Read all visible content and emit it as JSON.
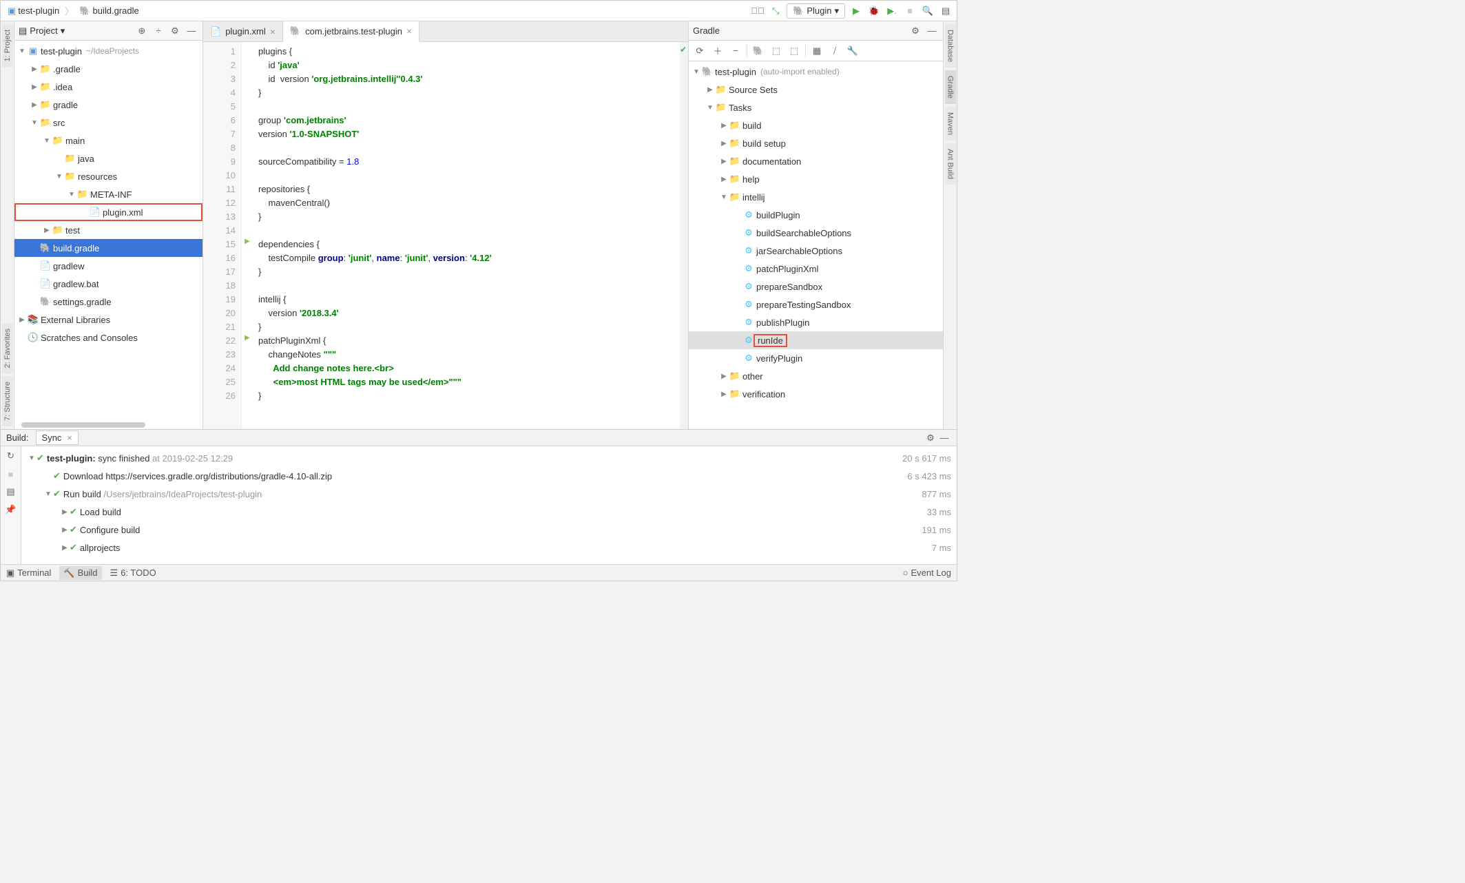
{
  "breadcrumb": {
    "project": "test-plugin",
    "file": "build.gradle"
  },
  "runConfig": {
    "label": "Plugin"
  },
  "projectPanel": {
    "title": "Project",
    "root": {
      "name": "test-plugin",
      "hint": "~/IdeaProjects"
    },
    "items": [
      {
        "name": ".gradle",
        "indent": 1,
        "arrow": "▶",
        "icon": "folder-orange"
      },
      {
        "name": ".idea",
        "indent": 1,
        "arrow": "▶",
        "icon": "folder"
      },
      {
        "name": "gradle",
        "indent": 1,
        "arrow": "▶",
        "icon": "folder"
      },
      {
        "name": "src",
        "indent": 1,
        "arrow": "▼",
        "icon": "folder-blue"
      },
      {
        "name": "main",
        "indent": 2,
        "arrow": "▼",
        "icon": "folder-blue"
      },
      {
        "name": "java",
        "indent": 3,
        "arrow": "",
        "icon": "folder-blue"
      },
      {
        "name": "resources",
        "indent": 3,
        "arrow": "▼",
        "icon": "folder-blue"
      },
      {
        "name": "META-INF",
        "indent": 4,
        "arrow": "▼",
        "icon": "folder"
      },
      {
        "name": "plugin.xml",
        "indent": 5,
        "arrow": "",
        "icon": "file",
        "highlight": true
      },
      {
        "name": "test",
        "indent": 2,
        "arrow": "▶",
        "icon": "folder-blue"
      },
      {
        "name": "build.gradle",
        "indent": 1,
        "arrow": "",
        "icon": "gradle",
        "selected": true
      },
      {
        "name": "gradlew",
        "indent": 1,
        "arrow": "",
        "icon": "file"
      },
      {
        "name": "gradlew.bat",
        "indent": 1,
        "arrow": "",
        "icon": "file"
      },
      {
        "name": "settings.gradle",
        "indent": 1,
        "arrow": "",
        "icon": "gradle"
      }
    ],
    "extLibs": "External Libraries",
    "scratches": "Scratches and Consoles"
  },
  "editor": {
    "tabs": [
      {
        "label": "plugin.xml",
        "active": false
      },
      {
        "label": "com.jetbrains.test-plugin",
        "active": true
      }
    ],
    "lineCount": 26,
    "code": [
      {
        "t": "plugins {"
      },
      {
        "t": "    id ",
        "s": "'java'"
      },
      {
        "t": "    id ",
        "s": "'org.jetbrains.intellij'",
        "t2": " version ",
        "s2": "'0.4.3'"
      },
      {
        "t": "}"
      },
      {
        "t": ""
      },
      {
        "t": "group ",
        "s": "'com.jetbrains'"
      },
      {
        "t": "version ",
        "s": "'1.0-SNAPSHOT'"
      },
      {
        "t": ""
      },
      {
        "t": "sourceCompatibility = ",
        "n": "1.8"
      },
      {
        "t": ""
      },
      {
        "t": "repositories {"
      },
      {
        "t": "    mavenCentral()"
      },
      {
        "t": "}"
      },
      {
        "t": ""
      },
      {
        "t": "dependencies {"
      },
      {
        "t": "    testCompile ",
        "k": "group",
        "t2": ": ",
        "s": "'junit'",
        "t3": ", ",
        "k2": "name",
        "t4": ": ",
        "s2": "'junit'",
        "t5": ", ",
        "k3": "version",
        "t6": ": ",
        "s3": "'4.12'"
      },
      {
        "t": "}"
      },
      {
        "t": ""
      },
      {
        "t": "intellij {"
      },
      {
        "t": "    version ",
        "s": "'2018.3.4'"
      },
      {
        "t": "}"
      },
      {
        "t": "patchPluginXml {"
      },
      {
        "t": "    changeNotes ",
        "s": "\"\"\""
      },
      {
        "s": "      Add change notes here.<br>"
      },
      {
        "s": "      <em>most HTML tags may be used</em>\"\"\""
      },
      {
        "t": "}"
      }
    ]
  },
  "gradlePanel": {
    "title": "Gradle",
    "root": {
      "name": "test-plugin",
      "hint": "(auto-import enabled)"
    },
    "items": [
      {
        "name": "Source Sets",
        "indent": 1,
        "arrow": "▶",
        "icon": "folder-task"
      },
      {
        "name": "Tasks",
        "indent": 1,
        "arrow": "▼",
        "icon": "folder-task"
      },
      {
        "name": "build",
        "indent": 2,
        "arrow": "▶",
        "icon": "folder-task"
      },
      {
        "name": "build setup",
        "indent": 2,
        "arrow": "▶",
        "icon": "folder-task"
      },
      {
        "name": "documentation",
        "indent": 2,
        "arrow": "▶",
        "icon": "folder-task"
      },
      {
        "name": "help",
        "indent": 2,
        "arrow": "▶",
        "icon": "folder-task"
      },
      {
        "name": "intellij",
        "indent": 2,
        "arrow": "▼",
        "icon": "folder-task"
      },
      {
        "name": "buildPlugin",
        "indent": 3,
        "arrow": "",
        "icon": "task"
      },
      {
        "name": "buildSearchableOptions",
        "indent": 3,
        "arrow": "",
        "icon": "task"
      },
      {
        "name": "jarSearchableOptions",
        "indent": 3,
        "arrow": "",
        "icon": "task"
      },
      {
        "name": "patchPluginXml",
        "indent": 3,
        "arrow": "",
        "icon": "task"
      },
      {
        "name": "prepareSandbox",
        "indent": 3,
        "arrow": "",
        "icon": "task"
      },
      {
        "name": "prepareTestingSandbox",
        "indent": 3,
        "arrow": "",
        "icon": "task"
      },
      {
        "name": "publishPlugin",
        "indent": 3,
        "arrow": "",
        "icon": "task"
      },
      {
        "name": "runIde",
        "indent": 3,
        "arrow": "",
        "icon": "task",
        "selected": true,
        "highlight": true
      },
      {
        "name": "verifyPlugin",
        "indent": 3,
        "arrow": "",
        "icon": "task"
      },
      {
        "name": "other",
        "indent": 2,
        "arrow": "▶",
        "icon": "folder-task"
      },
      {
        "name": "verification",
        "indent": 2,
        "arrow": "▶",
        "icon": "folder-task"
      }
    ]
  },
  "buildPanel": {
    "title": "Build:",
    "syncTab": "Sync",
    "rows": [
      {
        "indent": 0,
        "arrow": "▼",
        "check": true,
        "bold": "test-plugin:",
        "text": " sync finished",
        "hint": " at 2019-02-25 12:29",
        "time": "20 s 617 ms"
      },
      {
        "indent": 1,
        "arrow": "",
        "check": true,
        "text": "Download https://services.gradle.org/distributions/gradle-4.10-all.zip",
        "time": "6 s 423 ms"
      },
      {
        "indent": 1,
        "arrow": "▼",
        "check": true,
        "text": "Run build ",
        "hint": "/Users/jetbrains/IdeaProjects/test-plugin",
        "time": "877 ms"
      },
      {
        "indent": 2,
        "arrow": "▶",
        "check": true,
        "text": "Load build",
        "time": "33 ms"
      },
      {
        "indent": 2,
        "arrow": "▶",
        "check": true,
        "text": "Configure build",
        "time": "191 ms"
      },
      {
        "indent": 2,
        "arrow": "▶",
        "check": true,
        "text": "allprojects",
        "time": "7 ms"
      }
    ]
  },
  "statusBar": {
    "terminal": "Terminal",
    "build": "Build",
    "todo": "6: TODO",
    "eventLog": "Event Log"
  },
  "leftGutterTabs": [
    "1: Project",
    "2: Favorites",
    "7: Structure"
  ],
  "rightGutterTabs": [
    "Database",
    "Gradle",
    "Maven",
    "Ant Build"
  ]
}
